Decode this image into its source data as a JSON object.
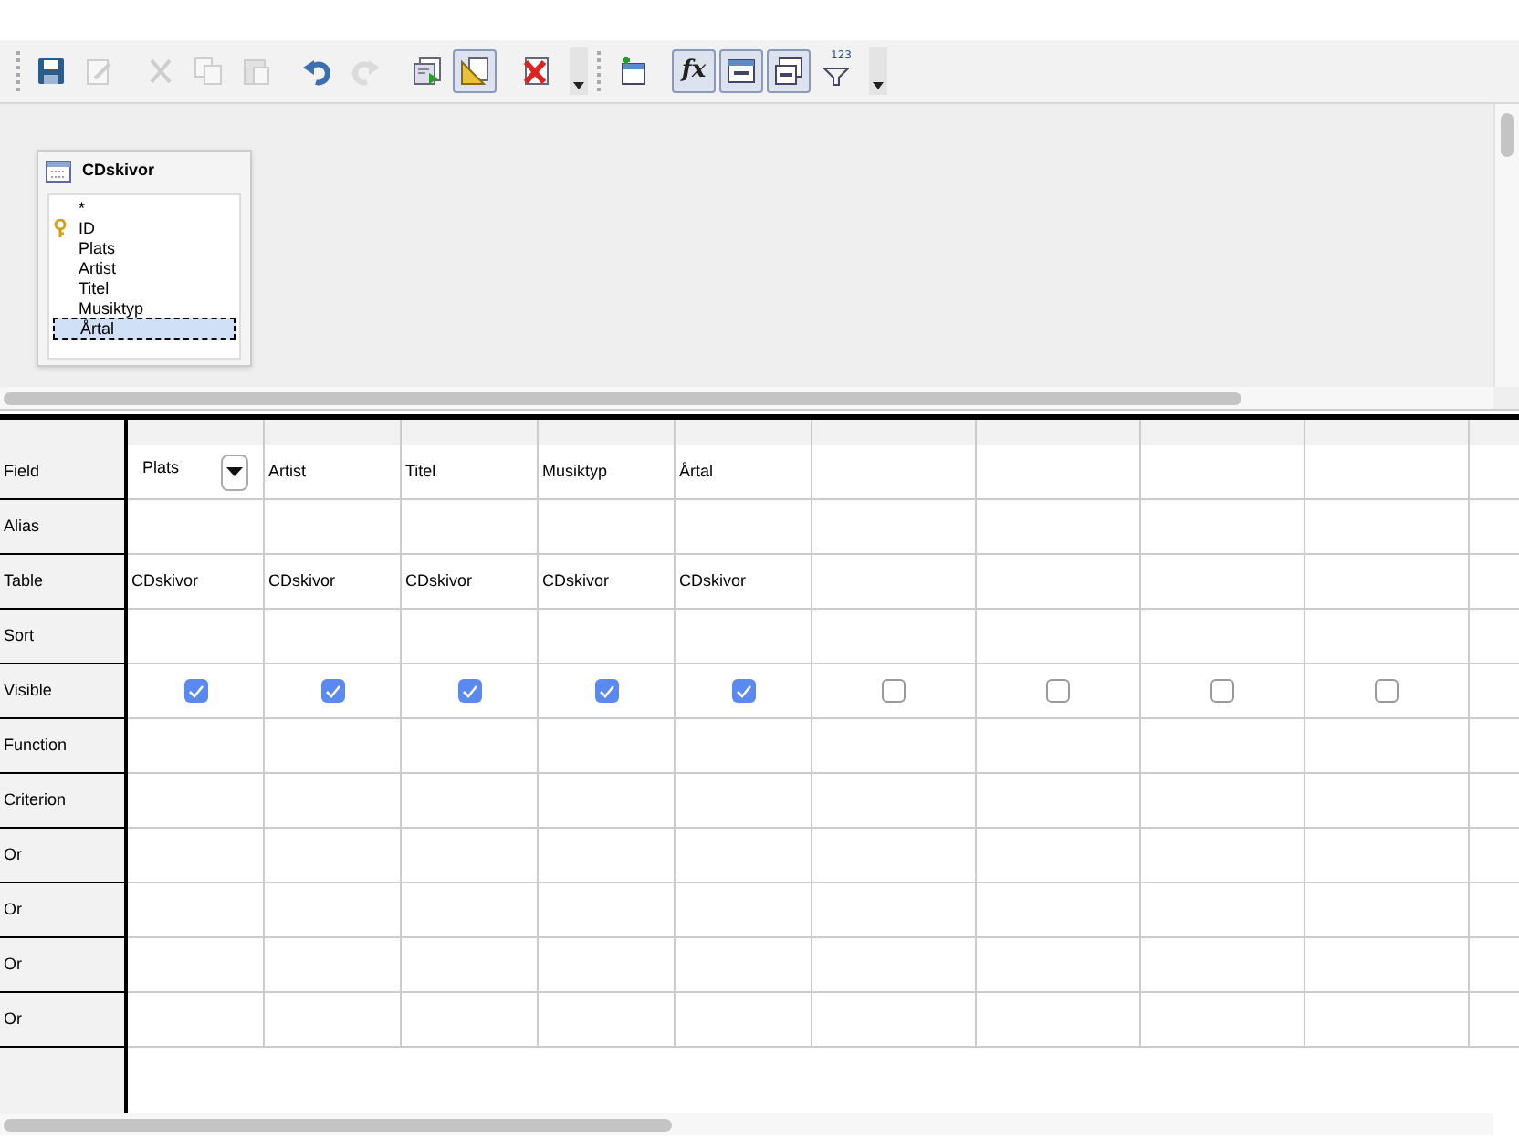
{
  "toolbar": {
    "groups": [
      [
        {
          "kind": "save",
          "disabled": false,
          "pressed": false
        },
        {
          "kind": "edit",
          "disabled": true,
          "pressed": false
        },
        {
          "kind": "cut",
          "disabled": true,
          "pressed": false
        },
        {
          "kind": "copy",
          "disabled": true,
          "pressed": false
        },
        {
          "kind": "paste",
          "disabled": true,
          "pressed": false
        },
        {
          "kind": "undo",
          "disabled": false,
          "pressed": false
        },
        {
          "kind": "redo",
          "disabled": true,
          "pressed": false
        },
        {
          "kind": "run",
          "disabled": false,
          "pressed": false
        },
        {
          "kind": "design",
          "disabled": false,
          "pressed": true
        },
        {
          "kind": "clear",
          "disabled": false,
          "pressed": false
        }
      ],
      [
        {
          "kind": "add-table",
          "disabled": false,
          "pressed": false
        },
        {
          "kind": "functions",
          "label": "fx",
          "disabled": false,
          "pressed": true
        },
        {
          "kind": "table-names",
          "disabled": false,
          "pressed": true
        },
        {
          "kind": "alias",
          "disabled": false,
          "pressed": true
        },
        {
          "kind": "distinct",
          "label": "123",
          "disabled": false,
          "pressed": false
        }
      ]
    ]
  },
  "table_window": {
    "title": "CDskivor",
    "fields": [
      {
        "name": "*",
        "key": false,
        "selected": false
      },
      {
        "name": "ID",
        "key": true,
        "selected": false
      },
      {
        "name": "Plats",
        "key": false,
        "selected": false
      },
      {
        "name": "Artist",
        "key": false,
        "selected": false
      },
      {
        "name": "Titel",
        "key": false,
        "selected": false
      },
      {
        "name": "Musiktyp",
        "key": false,
        "selected": false
      },
      {
        "name": "Årtal",
        "key": false,
        "selected": true
      }
    ]
  },
  "grid": {
    "row_labels": [
      "Field",
      "Alias",
      "Table",
      "Sort",
      "Visible",
      "Function",
      "Criterion",
      "Or",
      "Or",
      "Or",
      "Or"
    ],
    "columns": [
      {
        "field": "Plats",
        "table": "CDskivor",
        "visible": true,
        "editing": true
      },
      {
        "field": "Artist",
        "table": "CDskivor",
        "visible": true,
        "editing": false
      },
      {
        "field": "Titel",
        "table": "CDskivor",
        "visible": true,
        "editing": false
      },
      {
        "field": "Musiktyp",
        "table": "CDskivor",
        "visible": true,
        "editing": false
      },
      {
        "field": "Årtal",
        "table": "CDskivor",
        "visible": true,
        "editing": false
      },
      {
        "visible": false,
        "editing": false
      },
      {
        "visible": false,
        "editing": false
      },
      {
        "visible": false,
        "editing": false
      },
      {
        "visible": false,
        "editing": false
      }
    ]
  }
}
